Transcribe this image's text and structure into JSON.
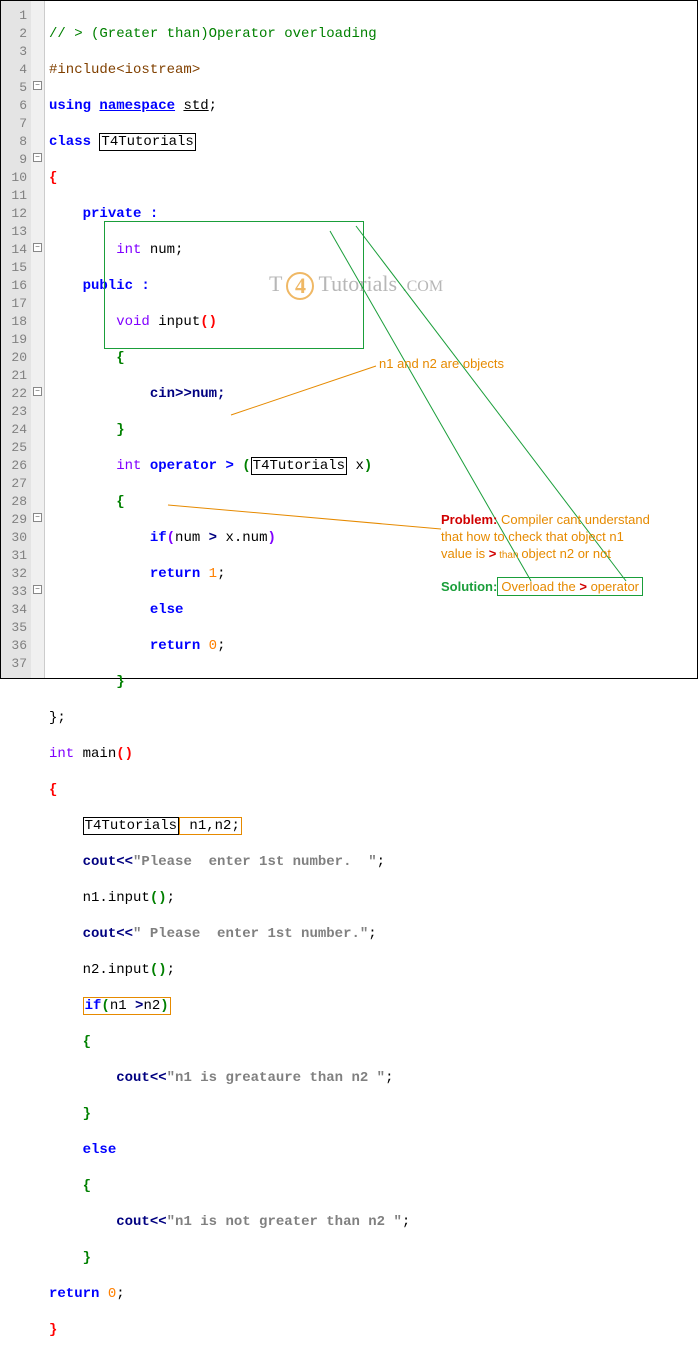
{
  "lines": [
    "1",
    "2",
    "3",
    "4",
    "5",
    "6",
    "7",
    "8",
    "9",
    "10",
    "11",
    "12",
    "13",
    "14",
    "15",
    "16",
    "17",
    "18",
    "19",
    "20",
    "21",
    "22",
    "23",
    "24",
    "25",
    "26",
    "27",
    "28",
    "29",
    "30",
    "31",
    "32",
    "33",
    "34",
    "35",
    "36",
    "37"
  ],
  "fold_rows": [
    5,
    9,
    14,
    22,
    29,
    33
  ],
  "code": {
    "l1_comment": "// > (Greater than)Operator overloading",
    "l2_pp": "#include<iostream>",
    "l3_using": "using",
    "l3_ns": "namespace",
    "l3_std": "std",
    "l3_semi": ";",
    "l4_class": "class",
    "l4_name": "T4Tutorials",
    "l5_brace": "{",
    "l6_priv": "private :",
    "l7_int": "int",
    "l7_num": " num;",
    "l8_pub": "public :",
    "l9_void": "void",
    "l9_input": " input",
    "l9_p": "()",
    "l10_brace": "{",
    "l11_cin": "cin",
    "l11_rest": ">>num;",
    "l12_brace": "}",
    "l13_int": "int",
    "l13_op": " operator ",
    "l13_gt": ">",
    "l13_po": " (",
    "l13_t4": "T4Tutorials",
    "l13_x": " x",
    "l13_pc": ")",
    "l14_brace": "{",
    "l15_if": "if",
    "l15_po": "(",
    "l15_body": "num",
    "l15_gt": ">",
    "l15_body2": " x.num",
    "l15_pc": ")",
    "l16_ret": "return",
    "l16_val": " 1",
    "l16_semi": ";",
    "l17_else": "else",
    "l18_ret": "return",
    "l18_val": " 0",
    "l18_semi": ";",
    "l19_brace": "}",
    "l20_end": "};",
    "l21_int": "int",
    "l21_main": " main",
    "l21_p": "()",
    "l22_brace": "{",
    "l23_t4": "T4Tutorials",
    "l23_vars": " n1,n2;",
    "l24_cout": "cout",
    "l24_op": "<<",
    "l24_str": "\"Please  enter 1st number.  \"",
    "l24_semi": ";",
    "l25": "n1.input",
    "l25_p": "()",
    "l25_s": ";",
    "l26_cout": "cout",
    "l26_op": "<<",
    "l26_str": "\" Please  enter 1st number.\"",
    "l26_semi": ";",
    "l27": "n2.input",
    "l27_p": "()",
    "l27_s": ";",
    "l28_if": "if",
    "l28_po": "(",
    "l28_n1": "n1 ",
    "l28_gt": ">",
    "l28_n2": "n2",
    "l28_pc": ")",
    "l29_brace": "{",
    "l30_cout": "cout",
    "l30_op": "<<",
    "l30_str": "\"n1 is greataure than n2 \"",
    "l30_semi": ";",
    "l31_brace": "}",
    "l32_else": "else",
    "l33_brace": "{",
    "l34_cout": "cout",
    "l34_op": "<<",
    "l34_str": "\"n1 is not greater than n2 \"",
    "l34_semi": ";",
    "l35_brace": "}",
    "l36_ret": "return",
    "l36_val": " 0",
    "l36_semi": ";",
    "l37_brace": "}"
  },
  "annot": {
    "objects": "n1 and n2 are objects",
    "problem_lbl": "Problem:",
    "problem_txt1": " Compiler cant understand",
    "problem_txt2": "that how to check that object n1",
    "problem_txt3a": "value is ",
    "problem_gt": ">",
    "problem_than": " than ",
    "problem_txt3b": " object n2 or not",
    "solution_lbl": "Solution:",
    "solution_txt1": "Overload the ",
    "solution_gt": ">",
    "solution_txt2": "  operator"
  },
  "watermark": {
    "t": "T",
    "four": "4",
    "tut": "Tutorials",
    "com": ".COM"
  }
}
